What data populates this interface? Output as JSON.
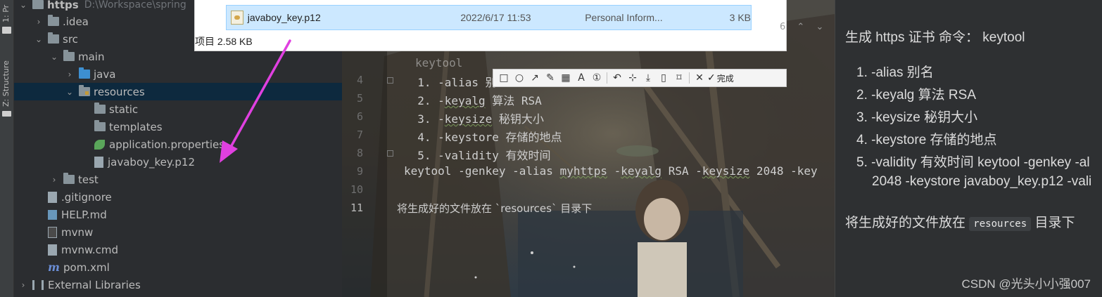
{
  "toolstrip": {
    "tab_project": "1: Pr",
    "tab_structure": "Z: Structure"
  },
  "project_tree": {
    "root": {
      "label": "https",
      "path": "D:\\Workspace\\spring"
    },
    "items": [
      {
        "label": ".idea",
        "kind": "folder",
        "indent": 1,
        "expanded": false
      },
      {
        "label": "src",
        "kind": "folder",
        "indent": 1,
        "expanded": true
      },
      {
        "label": "main",
        "kind": "folder",
        "indent": 2,
        "expanded": true
      },
      {
        "label": "java",
        "kind": "folder-blue",
        "indent": 3,
        "expanded": false
      },
      {
        "label": "resources",
        "kind": "folder-res",
        "indent": 3,
        "expanded": true,
        "selected": true
      },
      {
        "label": "static",
        "kind": "folder",
        "indent": 4
      },
      {
        "label": "templates",
        "kind": "folder",
        "indent": 4
      },
      {
        "label": "application.properties",
        "kind": "leaf",
        "indent": 4
      },
      {
        "label": "javaboy_key.p12",
        "kind": "key",
        "indent": 4
      },
      {
        "label": "test",
        "kind": "folder",
        "indent": 2,
        "expanded": false
      },
      {
        "label": ".gitignore",
        "kind": "file",
        "indent": 1
      },
      {
        "label": "HELP.md",
        "kind": "md",
        "indent": 1
      },
      {
        "label": "mvnw",
        "kind": "term",
        "indent": 1
      },
      {
        "label": "mvnw.cmd",
        "kind": "file",
        "indent": 1
      },
      {
        "label": "pom.xml",
        "kind": "m",
        "indent": 1
      },
      {
        "label": "External Libraries",
        "kind": "lib",
        "indent": 0,
        "expanded": false
      }
    ]
  },
  "explorer": {
    "file_name": "javaboy_key.p12",
    "date": "2022/6/17 11:53",
    "type": "Personal Inform...",
    "size": "3 KB",
    "status": "项目  2.58 KB"
  },
  "snip_toolbar": {
    "tools": [
      "rect-icon",
      "ellipse-icon",
      "arrow-icon",
      "pen-icon",
      "mosaic-icon",
      "text-icon",
      "number-icon",
      "undo-icon",
      "pin-icon",
      "download-icon",
      "save-icon",
      "bookmark-icon",
      "close-icon"
    ],
    "done_label": "完成"
  },
  "editor": {
    "lines": [
      {
        "n": "4",
        "text": "  1. -alias 别"
      },
      {
        "n": "5",
        "text": "  2. -keyalg 算法 RSA"
      },
      {
        "n": "6",
        "text": "  3. -keysize 秘钥大小"
      },
      {
        "n": "7",
        "text": "  4. -keystore 存储的地点"
      },
      {
        "n": "8",
        "text": "  5. -validity 有效时间"
      },
      {
        "n": "9",
        "text": "keytool -genkey -alias myhttps -keyalg RSA -keysize 2048 -key"
      },
      {
        "n": "10",
        "text": ""
      },
      {
        "n": "11",
        "text": "将生成好的文件放在 `resources` 目录下"
      }
    ],
    "top_partial": "keytool",
    "line_count_hint": "6"
  },
  "preview": {
    "heading": "生成 https 证书 命令： keytool",
    "items": [
      "1. -alias 别名",
      "2. -keyalg 算法 RSA",
      "3. -keysize 秘钥大小",
      "4. -keystore 存储的地点",
      "5. -validity 有效时间 keytool -genkey -al"
    ],
    "item5_cont": "2048 -keystore javaboy_key.p12 -vali",
    "para_before": "将生成好的文件放在",
    "para_code": "resources",
    "para_after": "目录下",
    "watermark": "CSDN @光头小小强007"
  },
  "colors": {
    "arrow": "#e040e0",
    "selection": "#0d293e",
    "explorer_highlight": "#cce8ff"
  }
}
